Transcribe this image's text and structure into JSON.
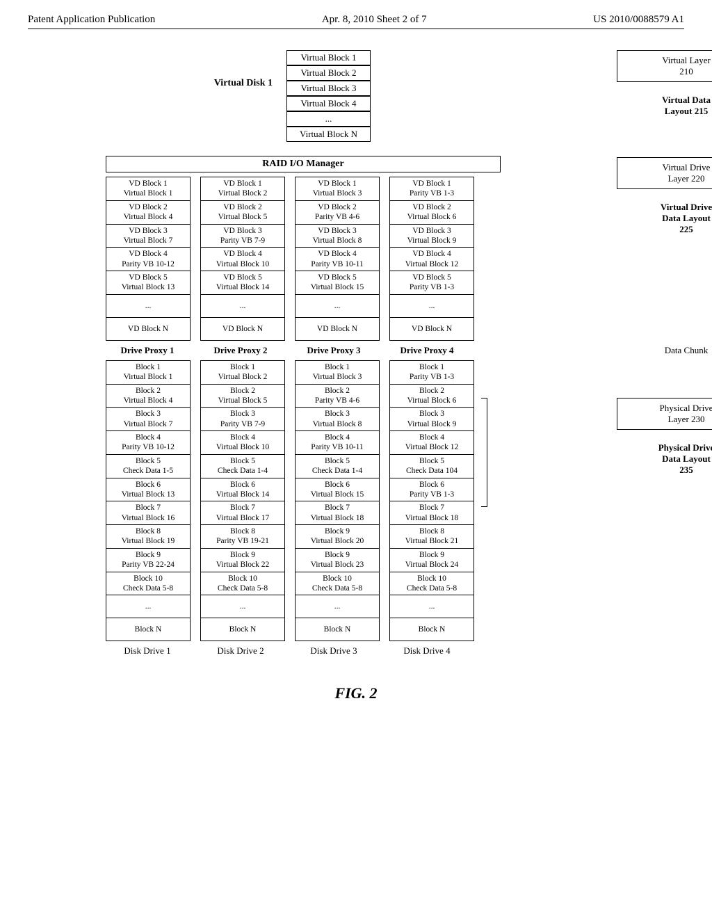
{
  "header": {
    "left": "Patent Application Publication",
    "center": "Apr. 8, 2010  Sheet 2 of 7",
    "right": "US 2010/0088579 A1"
  },
  "virtual_disk": {
    "label": "Virtual Disk 1",
    "blocks": [
      "Virtual Block 1",
      "Virtual Block 2",
      "Virtual Block 3",
      "Virtual Block 4",
      "...",
      "Virtual Block N"
    ]
  },
  "raid_manager": "RAID I/O Manager",
  "virtual_drive_cols": [
    [
      [
        "VD Block 1",
        "Virtual Block 1"
      ],
      [
        "VD Block 2",
        "Virtual Block 4"
      ],
      [
        "VD Block 3",
        "Virtual Block 7"
      ],
      [
        "VD Block 4",
        "Parity VB 10-12"
      ],
      [
        "VD Block 5",
        "Virtual Block 13"
      ],
      [
        "...",
        ""
      ],
      [
        "VD Block N",
        ""
      ]
    ],
    [
      [
        "VD Block 1",
        "Virtual Block 2"
      ],
      [
        "VD Block 2",
        "Virtual Block 5"
      ],
      [
        "VD Block 3",
        "Parity VB 7-9"
      ],
      [
        "VD Block 4",
        "Virtual Block 10"
      ],
      [
        "VD Block 5",
        "Virtual Block 14"
      ],
      [
        "...",
        ""
      ],
      [
        "VD Block N",
        ""
      ]
    ],
    [
      [
        "VD Block 1",
        "Virtual Block 3"
      ],
      [
        "VD Block 2",
        "Parity VB 4-6"
      ],
      [
        "VD Block 3",
        "Virtual Block 8"
      ],
      [
        "VD Block 4",
        "Parity VB 10-11"
      ],
      [
        "VD Block 5",
        "Virtual Block 15"
      ],
      [
        "...",
        ""
      ],
      [
        "VD Block N",
        ""
      ]
    ],
    [
      [
        "VD Block 1",
        "Parity VB 1-3"
      ],
      [
        "VD Block 2",
        "Virtual Block 6"
      ],
      [
        "VD Block 3",
        "Virtual Block 9"
      ],
      [
        "VD Block 4",
        "Virtual Block 12"
      ],
      [
        "VD Block 5",
        "Parity VB 1-3"
      ],
      [
        "...",
        ""
      ],
      [
        "VD Block N",
        ""
      ]
    ]
  ],
  "drive_proxies": [
    "Drive Proxy 1",
    "Drive Proxy 2",
    "Drive Proxy 3",
    "Drive Proxy 4"
  ],
  "physical_cols": [
    [
      [
        "Block 1",
        "Virtual Block 1"
      ],
      [
        "Block 2",
        "Virtual Block 4"
      ],
      [
        "Block 3",
        "Virtual Block 7"
      ],
      [
        "Block 4",
        "Parity VB 10-12"
      ],
      [
        "Block 5",
        "Check Data 1-5"
      ],
      [
        "Block 6",
        "Virtual Block 13"
      ],
      [
        "Block 7",
        "Virtual Block 16"
      ],
      [
        "Block 8",
        "Virtual Block 19"
      ],
      [
        "Block 9",
        "Parity VB 22-24"
      ],
      [
        "Block 10",
        "Check Data 5-8"
      ],
      [
        "...",
        ""
      ],
      [
        "Block N",
        ""
      ]
    ],
    [
      [
        "Block 1",
        "Virtual Block 2"
      ],
      [
        "Block 2",
        "Virtual Block 5"
      ],
      [
        "Block 3",
        "Parity VB 7-9"
      ],
      [
        "Block 4",
        "Virtual Block 10"
      ],
      [
        "Block 5",
        "Check Data 1-4"
      ],
      [
        "Block 6",
        "Virtual Block 14"
      ],
      [
        "Block 7",
        "Virtual Block 17"
      ],
      [
        "Block 8",
        "Parity VB 19-21"
      ],
      [
        "Block 9",
        "Virtual Block 22"
      ],
      [
        "Block 10",
        "Check Data 5-8"
      ],
      [
        "...",
        ""
      ],
      [
        "Block N",
        ""
      ]
    ],
    [
      [
        "Block 1",
        "Virtual Block 3"
      ],
      [
        "Block 2",
        "Parity VB 4-6"
      ],
      [
        "Block 3",
        "Virtual Block 8"
      ],
      [
        "Block 4",
        "Parity VB 10-11"
      ],
      [
        "Block 5",
        "Check Data 1-4"
      ],
      [
        "Block 6",
        "Virtual Block 15"
      ],
      [
        "Block 7",
        "Virtual Block 18"
      ],
      [
        "Block 9",
        "Virtual Block 20"
      ],
      [
        "Block 9",
        "Virtual Block 23"
      ],
      [
        "Block 10",
        "Check Data 5-8"
      ],
      [
        "...",
        ""
      ],
      [
        "Block N",
        ""
      ]
    ],
    [
      [
        "Block 1",
        "Parity VB 1-3"
      ],
      [
        "Block 2",
        "Virtual Block 6"
      ],
      [
        "Block 3",
        "Virtual Block 9"
      ],
      [
        "Block 4",
        "Virtual Block 12"
      ],
      [
        "Block 5",
        "Check Data 104"
      ],
      [
        "Block 6",
        "Parity VB 1-3"
      ],
      [
        "Block 7",
        "Virtual Block 18"
      ],
      [
        "Block 8",
        "Virtual Block 21"
      ],
      [
        "Block 9",
        "Virtual Block 24"
      ],
      [
        "Block 10",
        "Check Data 5-8"
      ],
      [
        "...",
        ""
      ],
      [
        "Block N",
        ""
      ]
    ]
  ],
  "disk_drives": [
    "Disk Drive 1",
    "Disk Drive 2",
    "Disk Drive 3",
    "Disk Drive 4"
  ],
  "side": {
    "virtual_layer_box": "Virtual Layer\n210",
    "virtual_data_layout": "Virtual Data\nLayout 215",
    "virtual_drive_box": "Virtual Drive\nLayer 220",
    "virtual_drive_data_layout": "Virtual Drive\nData Layout\n225",
    "data_chunk": "Data Chunk",
    "physical_drive_box": "Physical Drive\nLayer 230",
    "physical_drive_data_layout": "Physical Drive\nData Layout\n235"
  },
  "figure_caption": "FIG. 2"
}
